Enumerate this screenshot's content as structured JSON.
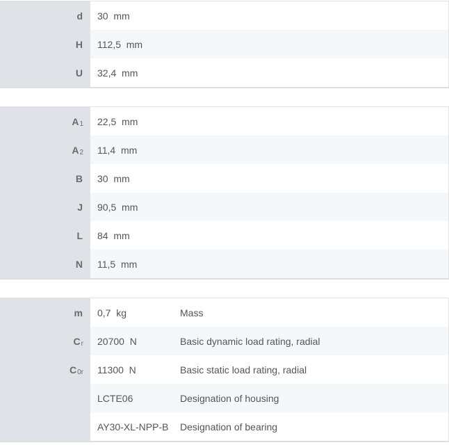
{
  "tables": [
    {
      "rows": [
        {
          "symbol": "d",
          "sub": "",
          "value": "30  mm"
        },
        {
          "symbol": "H",
          "sub": "",
          "value": "112,5  mm"
        },
        {
          "symbol": "U",
          "sub": "",
          "value": "32,4  mm"
        }
      ]
    },
    {
      "rows": [
        {
          "symbol": "A",
          "sub": "1",
          "value": "22,5  mm"
        },
        {
          "symbol": "A",
          "sub": "2",
          "value": "11,4  mm"
        },
        {
          "symbol": "B",
          "sub": "",
          "value": "30  mm"
        },
        {
          "symbol": "J",
          "sub": "",
          "value": "90,5  mm"
        },
        {
          "symbol": "L",
          "sub": "",
          "value": "84  mm"
        },
        {
          "symbol": "N",
          "sub": "",
          "value": "11,5  mm"
        }
      ]
    },
    {
      "rows": [
        {
          "symbol": "m",
          "sub": "",
          "value": "0,7  kg",
          "description": "Mass"
        },
        {
          "symbol": "C",
          "sub": "r",
          "value": "20700  N",
          "description": "Basic dynamic load rating, radial"
        },
        {
          "symbol": "C",
          "sub": "0r",
          "value": "11300  N",
          "description": "Basic static load rating, radial"
        },
        {
          "symbol": "",
          "sub": "",
          "value": "LCTE06",
          "description": "Designation of housing"
        },
        {
          "symbol": "",
          "sub": "",
          "value": "AY30-XL-NPP-B",
          "description": "Designation of bearing"
        }
      ]
    }
  ]
}
